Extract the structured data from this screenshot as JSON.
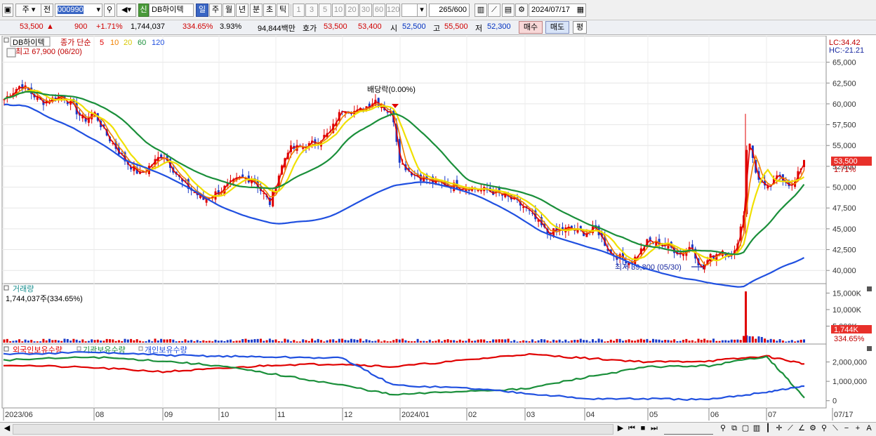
{
  "toolbar": {
    "market": "주",
    "prev_label": "전",
    "code": "000990",
    "stock_badge": "신",
    "stock_name": "DB하이텍",
    "periods": [
      "일",
      "주",
      "월",
      "년",
      "분",
      "초",
      "틱"
    ],
    "active_period": "일",
    "ticks": [
      "1",
      "3",
      "5",
      "10",
      "20",
      "30",
      "60",
      "120"
    ],
    "count": "265",
    "count_total": "/600",
    "date": "2024/07/17"
  },
  "quote": {
    "price": "53,500",
    "change_arrow": "▲",
    "change": "900",
    "change_pct": "+1.71%",
    "volume": "1,744,037",
    "volume_ratio": "334.65%",
    "turnover": "3.93%",
    "amount": "94,844백만",
    "ask_label": "호가",
    "ask": "53,500",
    "bid": "53,400",
    "open_label": "시",
    "open": "52,500",
    "high_label": "고",
    "high": "55,500",
    "low_label": "저",
    "low": "52,300",
    "buy_button": "매수",
    "sell_button": "매도",
    "eval_button": "평"
  },
  "price_panel": {
    "legend_name": "DB하이텍",
    "legend_ma_label": "종가 단순",
    "ma_periods": [
      "5",
      "10",
      "20",
      "60",
      "120"
    ],
    "ma_colors": [
      "#e00000",
      "#f08000",
      "#f0e000",
      "#1a8f3a",
      "#2050e0"
    ],
    "high_note": "최고 67,900 (06/20)",
    "low_note": "최저 39,800 (05/30)",
    "dividend_note": "배당락(0.00%)",
    "lc": "LC:34.42",
    "hc": "HC:-21.21",
    "current_price_tag": "53,500",
    "current_pct_tag": "1.71%",
    "y_ticks": [
      "65,000",
      "62,500",
      "60,000",
      "57,500",
      "55,000",
      "52,500",
      "50,000",
      "47,500",
      "45,000",
      "42,500",
      "40,000"
    ]
  },
  "volume_panel": {
    "title": "거래량",
    "value_line": "1,744,037주(334.65%)",
    "y_ticks": [
      "15,000K",
      "10,000K",
      "5,000K"
    ],
    "current_tag": "1,744K",
    "current_pct": "334.65%"
  },
  "holding_panel": {
    "series": [
      {
        "name": "외국인보유수량",
        "color": "#e00000"
      },
      {
        "name": "기관보유수량",
        "color": "#1a8f3a"
      },
      {
        "name": "개인보유수량",
        "color": "#2050e0"
      }
    ],
    "y_ticks": [
      "2,000,000",
      "1,000,000",
      "0"
    ]
  },
  "x_axis": {
    "labels": [
      "2023/06",
      "08",
      "09",
      "10",
      "11",
      "12",
      "2024/01",
      "02",
      "03",
      "04",
      "05",
      "06",
      "07",
      "07/17"
    ]
  },
  "chart_data": {
    "type": "line",
    "title": "",
    "price_ylim": [
      38500,
      68000
    ],
    "months_anchor_prices": [
      {
        "month": "2023/06",
        "close": 63000
      },
      {
        "month": "08",
        "close": 59000
      },
      {
        "month": "09",
        "close": 52000
      },
      {
        "month": "10",
        "close": 49000
      },
      {
        "month": "11",
        "close": 52000
      },
      {
        "month": "12",
        "close": 59500
      },
      {
        "month": "2024/01",
        "close": 51500
      },
      {
        "month": "02",
        "close": 50000
      },
      {
        "month": "03",
        "close": 45000
      },
      {
        "month": "04",
        "close": 44000
      },
      {
        "month": "05",
        "close": 41500
      },
      {
        "month": "06",
        "close": 42000
      },
      {
        "month": "07",
        "close": 53500
      }
    ],
    "volume_spike_k": 15500,
    "holdings_ylim": [
      -300000,
      2600000
    ],
    "series": [
      {
        "name": "외국인보유수량",
        "values": [
          1850000,
          1700000,
          1500000,
          1650000,
          1850000,
          1900000,
          1750000,
          2100000,
          2400000,
          2200000,
          2000000,
          2050000,
          2300000,
          1900000
        ]
      },
      {
        "name": "기관보유수량",
        "values": [
          2100000,
          2250000,
          2050000,
          1800000,
          1350000,
          800000,
          300000,
          500000,
          600000,
          1200000,
          1750000,
          1800000,
          2300000,
          150000
        ]
      },
      {
        "name": "개인보유수량",
        "values": [
          2400000,
          2500000,
          2350000,
          2300000,
          2250000,
          2200000,
          800000,
          650000,
          400000,
          100000,
          100000,
          50000,
          450000,
          750000
        ]
      }
    ]
  },
  "bottom": {
    "zoom_label": "A"
  }
}
